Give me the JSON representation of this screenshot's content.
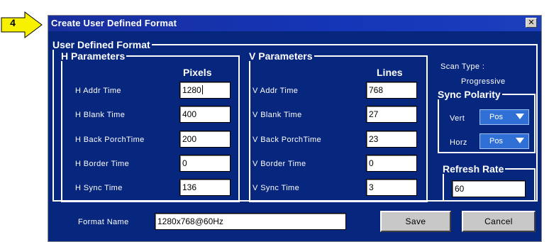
{
  "step_number": "4",
  "dialog": {
    "title": "Create User Defined Format",
    "close_glyph": "x"
  },
  "user_defined_format": {
    "legend": "User Defined Format",
    "h_parameters": {
      "legend": "H Parameters",
      "column_header": "Pixels",
      "rows": [
        {
          "label": "H Addr Time",
          "value": "1280"
        },
        {
          "label": "H Blank Time",
          "value": "400"
        },
        {
          "label": "H Back PorchTime",
          "value": "200"
        },
        {
          "label": "H Border Time",
          "value": "0"
        },
        {
          "label": "H Sync Time",
          "value": "136"
        }
      ]
    },
    "v_parameters": {
      "legend": "V Parameters",
      "column_header": "Lines",
      "rows": [
        {
          "label": "V Addr Time",
          "value": "768"
        },
        {
          "label": "V Blank Time",
          "value": "27"
        },
        {
          "label": "V Back PorchTime",
          "value": "23"
        },
        {
          "label": "V Border Time",
          "value": "0"
        },
        {
          "label": "V Sync Time",
          "value": "3"
        }
      ]
    },
    "scan_type": {
      "label": "Scan Type :",
      "value": "Progressive"
    },
    "sync_polarity": {
      "legend": "Sync Polarity",
      "vert_label": "Vert",
      "vert_value": "Pos",
      "horz_label": "Horz",
      "horz_value": "Pos"
    },
    "refresh_rate": {
      "legend": "Refresh Rate",
      "value": "60"
    }
  },
  "format_name": {
    "label": "Format Name",
    "value": "1280x768@60Hz"
  },
  "buttons": {
    "save": "Save",
    "cancel": "Cancel"
  },
  "colors": {
    "dialog_bg": "#07267e",
    "titlebar": "#1436b8",
    "dropdown": "#2f6fd6",
    "badge": "#f7f100"
  },
  "icons": {
    "step_arrow": "step-arrow-icon",
    "close": "close-icon",
    "dropdown_caret": "chevron-down-icon"
  }
}
